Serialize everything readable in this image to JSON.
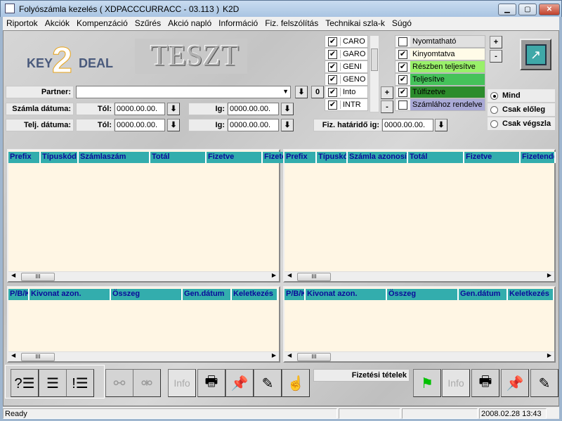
{
  "window": {
    "title": "Folyószámla kezelés ( XDPACCCURRACC - 03.113 )",
    "app": "K2D"
  },
  "menu": [
    "Riportok",
    "Akciók",
    "Kompenzáció",
    "Szűrés",
    "Akció napló",
    "Információ",
    "Fiz. felszólítás",
    "Technikai szla-k",
    "Súgó"
  ],
  "logo": {
    "text_key": "KEY",
    "text_2": "2",
    "text_deal": "DEAL"
  },
  "environment_banner": "TESZT",
  "type_filter": [
    {
      "code": "CARO",
      "checked": true
    },
    {
      "code": "GARO",
      "checked": true
    },
    {
      "code": "GENI",
      "checked": true
    },
    {
      "code": "GENO",
      "checked": true
    },
    {
      "code": "Into",
      "checked": true
    },
    {
      "code": "INTR",
      "checked": true
    }
  ],
  "status_filter": [
    {
      "label": "Nyomtatható",
      "checked": false,
      "color": "#e0e0e0"
    },
    {
      "label": "Kinyomtatva",
      "checked": true,
      "color": "#fffbe8"
    },
    {
      "label": "Részben teljesítve",
      "checked": true,
      "color": "#99f06a"
    },
    {
      "label": "Teljesítve",
      "checked": true,
      "color": "#45c25a"
    },
    {
      "label": "Túlfizetve",
      "checked": true,
      "color": "#2c8c2c"
    },
    {
      "label": "Számlához rendelve",
      "checked": false,
      "color": "#a9a9d6"
    }
  ],
  "plus": "+",
  "minus": "-",
  "filters": {
    "partner_label": "Partner:",
    "partner_value": "",
    "zero_button": "0",
    "szamla_label": "Számla dátuma:",
    "telj_label": "Telj. dátuma:",
    "tol": "Tól:",
    "ig": "Ig:",
    "szamla_tol": "0000.00.00.",
    "szamla_ig": "0000.00.00.",
    "telj_tol": "0000.00.00.",
    "telj_ig": "0000.00.00.",
    "fiz_label": "Fiz. határidő ig:",
    "fiz_value": "0000.00.00."
  },
  "radios": [
    {
      "label": "Mind",
      "selected": true
    },
    {
      "label": "Csak előleg",
      "selected": false
    },
    {
      "label": "Csak végszla",
      "selected": false
    }
  ],
  "grid_left_top": [
    "Prefix",
    "Típuskód",
    "Számlaszám",
    "Totál",
    "Fizetve",
    "Fizetendő"
  ],
  "grid_right_top": [
    "Prefix",
    "Típuskód",
    "Számla azonosító",
    "Totál",
    "Fizetve",
    "Fizetendő"
  ],
  "grid_left_bottom": [
    "P/B/K",
    "Kivonat azon.",
    "Összeg",
    "Gen.dátum",
    "Keletkezés"
  ],
  "grid_right_bottom": [
    "P/B/K",
    "Kivonat azon.",
    "Összeg",
    "Gen.dátum",
    "Keletkezés"
  ],
  "toolbar": {
    "info": "Info",
    "payments_label": "Fizetési tételek"
  },
  "statusbar": {
    "text": "Ready",
    "datetime": "2008.02.28 13:43"
  }
}
